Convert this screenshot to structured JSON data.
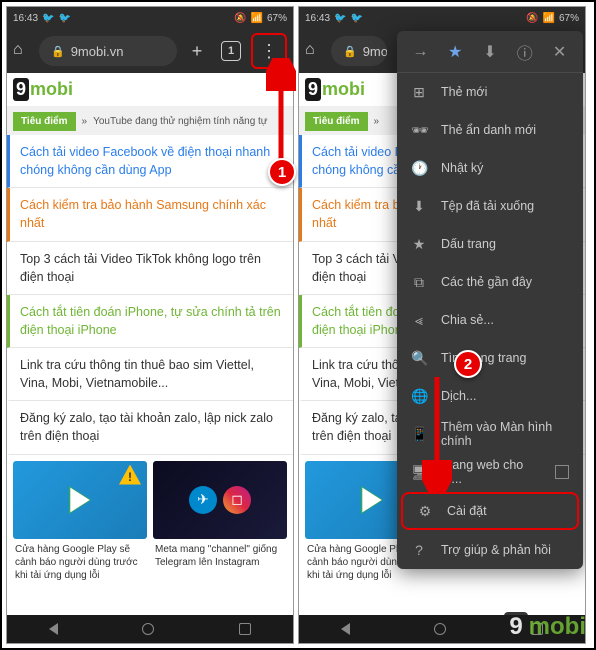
{
  "status": {
    "time": "16:43",
    "battery": "67%"
  },
  "toolbar": {
    "url": "9mobi.vn",
    "url_short": "9mobi...",
    "tab_count": "1"
  },
  "logo": {
    "prefix": "9",
    "suffix": "mobi"
  },
  "nav": {
    "active": "Tiêu điểm",
    "trail": "YouTube đang thử nghiệm tính năng tự"
  },
  "articles": [
    {
      "text": "Cách tải video Facebook về điện thoại nhanh chóng không cần dùng App",
      "cls": "blue"
    },
    {
      "text": "Cách kiểm tra bảo hành Samsung chính xác nhất",
      "cls": "orange"
    },
    {
      "text": "Top 3 cách tải Video TikTok không logo trên điện thoại",
      "cls": ""
    },
    {
      "text": "Cách tắt tiên đoán iPhone, tự sửa chính tả trên điện thoại iPhone",
      "cls": "green"
    },
    {
      "text": "Link tra cứu thông tin thuê bao sim Viettel, Vina, Mobi, Vietnamobile...",
      "cls": ""
    },
    {
      "text": "Đăng ký zalo, tạo tài khoản zalo, lập nick zalo trên điện thoại",
      "cls": ""
    }
  ],
  "articles_r": [
    {
      "text": "Cách tải video Facebook về điện thoại nhanh chóng không cần dùng App",
      "cls": "blue"
    },
    {
      "text": "Cách kiểm tra bảo hành Samsung chính xác nhất",
      "cls": "orange"
    },
    {
      "text": "Top 3 cách tải Video TikTok không logo trên điện thoại",
      "cls": ""
    },
    {
      "text": "Cách tắt tiên đoán iPhone, tự sửa chính tả trên điện thoại iPhone",
      "cls": "green"
    },
    {
      "text": "Link tra cứu thông tin thuê bao sim Viettel, Vina, Mobi, Vietnamobile...",
      "cls": ""
    },
    {
      "text": "Đăng ký zalo, tạo tài khoản zalo, lập nick zalo trên điện thoại",
      "cls": ""
    }
  ],
  "thumbs": [
    {
      "title": "Cửa hàng Google Play sẽ cảnh báo người dùng trước khi tải ứng dụng lỗi"
    },
    {
      "title": "Meta mang \"channel\" giống Telegram lên Instagram"
    }
  ],
  "menu": {
    "new_tab": "Thẻ mới",
    "incognito": "Thẻ ẩn danh mới",
    "history": "Nhật ký",
    "downloads": "Tệp đã tải xuống",
    "bookmarks": "Dấu trang",
    "recent_tabs": "Các thẻ gần đây",
    "share": "Chia sẻ...",
    "find": "Tìm trong trang",
    "translate": "Dịch...",
    "add_home": "Thêm vào Màn hình chính",
    "desktop": "Trang web cho m...",
    "settings": "Cài đặt",
    "help": "Trợ giúp & phản hồi"
  },
  "step1": "1",
  "step2": "2"
}
